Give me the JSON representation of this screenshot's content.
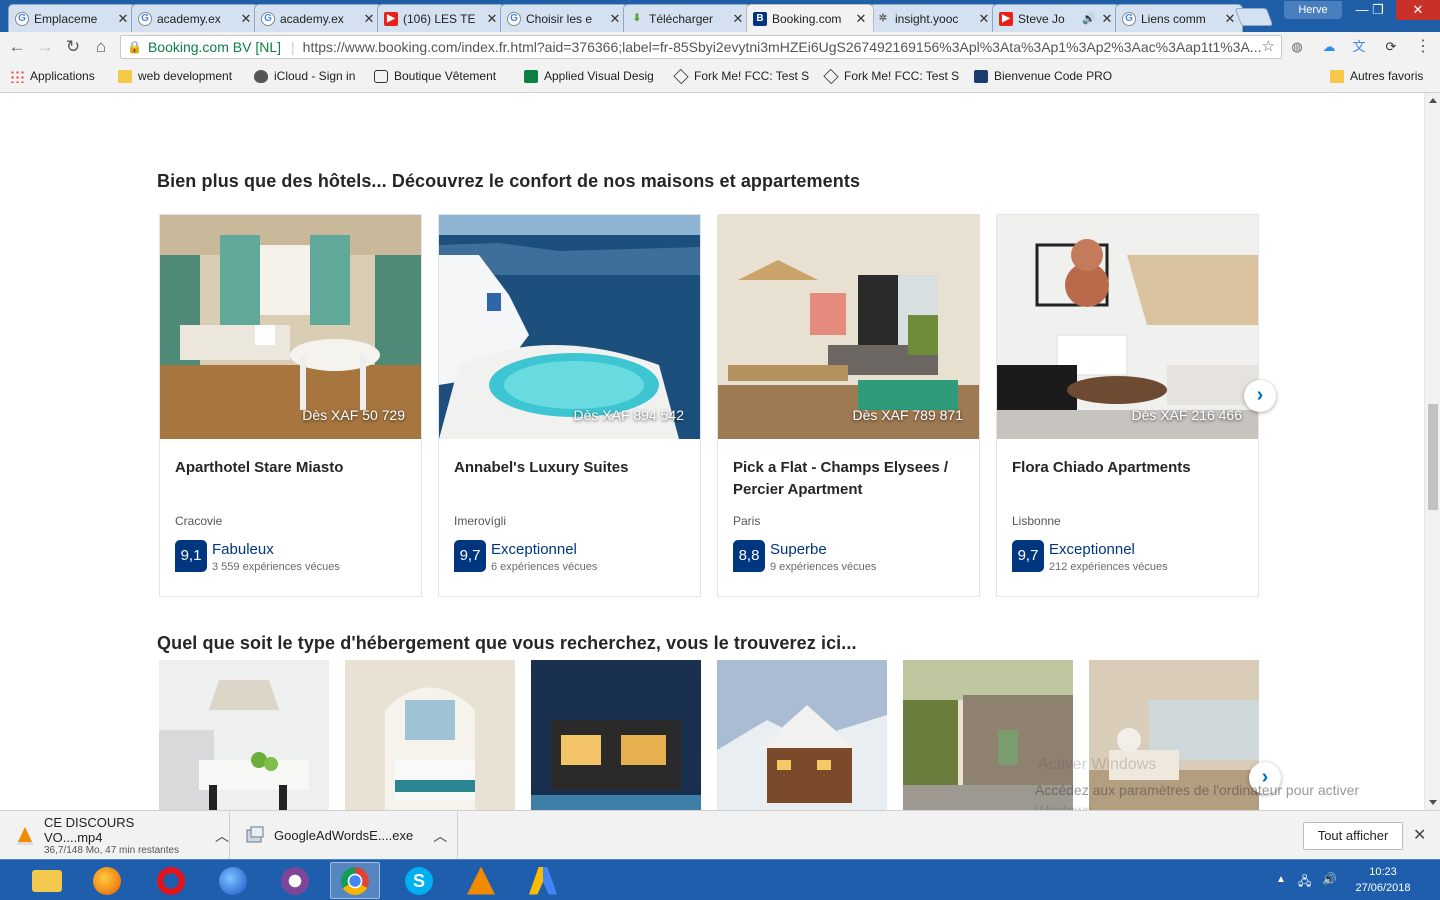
{
  "browser": {
    "tabs": [
      {
        "label": "Emplaceme",
        "favicon": "google-icon"
      },
      {
        "label": "academy.ex",
        "favicon": "google-icon"
      },
      {
        "label": "academy.ex",
        "favicon": "google-icon"
      },
      {
        "label": "(106) LES TE",
        "favicon": "youtube-icon"
      },
      {
        "label": "Choisir les e",
        "favicon": "google-icon"
      },
      {
        "label": "Télécharger",
        "favicon": "download-icon"
      },
      {
        "label": "Booking.com",
        "favicon": "booking-icon",
        "active": true
      },
      {
        "label": "insight.yooc",
        "favicon": "gear-icon"
      },
      {
        "label": "Steve Jo",
        "favicon": "youtube-icon"
      },
      {
        "label": "Liens comm",
        "favicon": "google-icon"
      }
    ],
    "profile_name": "Herve",
    "address": {
      "site_identity": "Booking.com BV [NL]",
      "url": "https://www.booking.com/index.fr.html?aid=376366;label=fr-85Sbyi2evytni3mHZEi6UgS267492169156%3Apl%3Ata%3Ap1%3Ap2%3Aac%3Aap1t1%3A..."
    },
    "bookmarks": [
      {
        "label": "Applications",
        "icon": "apps-grid-icon"
      },
      {
        "label": "web development",
        "icon": "folder-icon"
      },
      {
        "label": "iCloud - Sign in",
        "icon": "apple-icon"
      },
      {
        "label": "Boutique Vêtement",
        "icon": "camera-icon"
      },
      {
        "label": "Applied Visual Desig",
        "icon": "fcc-icon"
      },
      {
        "label": "Fork Me! FCC: Test S",
        "icon": "codepen-icon"
      },
      {
        "label": "Fork Me! FCC: Test S",
        "icon": "codepen-icon"
      },
      {
        "label": "Bienvenue Code PRO",
        "icon": "codepro-icon"
      },
      {
        "label": "Autres favoris",
        "icon": "folder-icon"
      }
    ]
  },
  "page": {
    "homes_heading": "Bien plus que des hôtels... Découvrez le confort de nos maisons et appartements",
    "types_heading": "Quel que soit le type d'hébergement que vous recherchez, vous le trouverez ici...",
    "properties": [
      {
        "name": "Aparthotel Stare Miasto",
        "city": "Cracovie",
        "price": "Dès XAF 50 729",
        "score": "9,1",
        "rating_label": "Fabuleux",
        "reviews": "3 559 expériences vécues"
      },
      {
        "name": "Annabel's Luxury Suites",
        "city": "Imerovígli",
        "price": "Dès XAF 894 542",
        "score": "9,7",
        "rating_label": "Exceptionnel",
        "reviews": "6 expériences vécues"
      },
      {
        "name": "Pick a Flat - Champs Elysees / Percier Apartment",
        "city": "Paris",
        "price": "Dès XAF 789 871",
        "score": "8,8",
        "rating_label": "Superbe",
        "reviews": "9 expériences vécues"
      },
      {
        "name": "Flora Chiado Apartments",
        "city": "Lisbonne",
        "price": "Dès XAF 216 466",
        "score": "9,7",
        "rating_label": "Exceptionnel",
        "reviews": "212 expériences vécues"
      }
    ],
    "brand_color": "#003580",
    "link_color": "#0071c2"
  },
  "windows_watermark": {
    "line1": "Activer Windows",
    "line2": "Accédez aux paramètres de l'ordinateur pour activer",
    "line3": "Windows."
  },
  "downloads": {
    "items": [
      {
        "filename": "CE DISCOURS VO....mp4",
        "status": "36,7/148 Mo, 47 min restantes",
        "icon": "vlc-icon"
      },
      {
        "filename": "GoogleAdWordsE....exe",
        "status": "",
        "icon": "installer-icon"
      }
    ],
    "show_all_label": "Tout afficher"
  },
  "taskbar": {
    "apps": [
      "explorer-icon",
      "firefox-icon",
      "opera-icon",
      "firefox-dev-icon",
      "tor-icon",
      "chrome-icon",
      "skype-icon",
      "vlc-icon",
      "adwords-icon"
    ],
    "time": "10:23",
    "date": "27/06/2018"
  }
}
